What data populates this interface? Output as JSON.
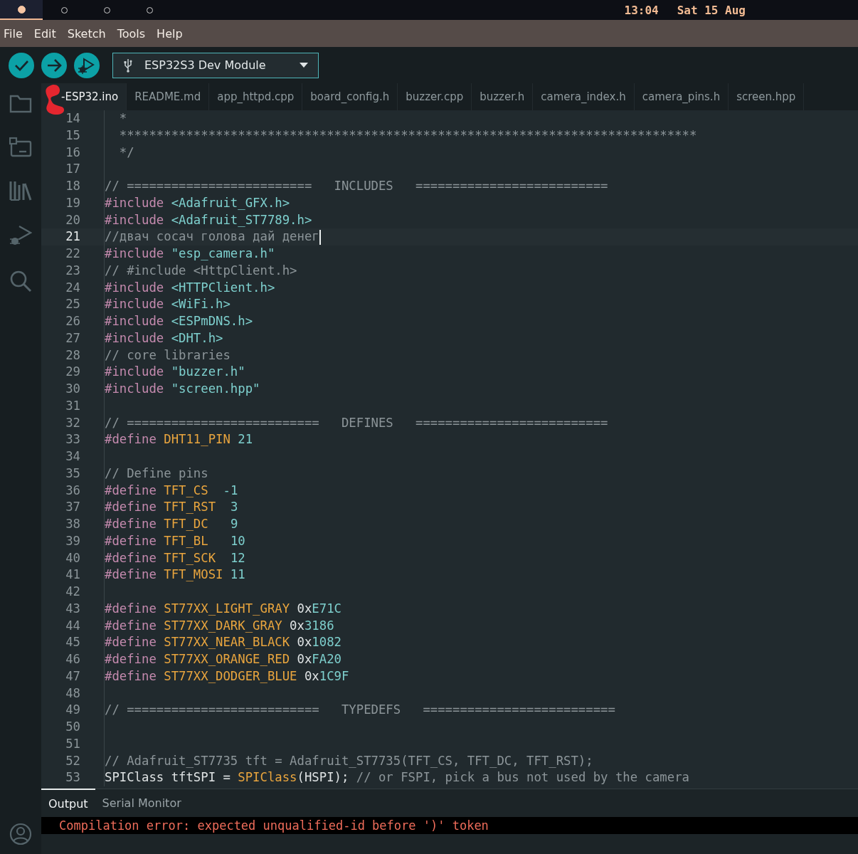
{
  "top_bar": {
    "workspaces": [
      {
        "selected": true
      },
      {
        "selected": false
      },
      {
        "selected": false
      },
      {
        "selected": false
      }
    ],
    "time": "13:04",
    "date": "Sat 15 Aug"
  },
  "menu": [
    "File",
    "Edit",
    "Sketch",
    "Tools",
    "Help"
  ],
  "toolbar": {
    "board": "ESP32S3 Dev Module"
  },
  "tabs": [
    {
      "label": "-ESP32.ino",
      "selected": true
    },
    {
      "label": "README.md",
      "selected": false
    },
    {
      "label": "app_httpd.cpp",
      "selected": false
    },
    {
      "label": "board_config.h",
      "selected": false
    },
    {
      "label": "buzzer.cpp",
      "selected": false
    },
    {
      "label": "buzzer.h",
      "selected": false
    },
    {
      "label": "camera_index.h",
      "selected": false
    },
    {
      "label": "camera_pins.h",
      "selected": false
    },
    {
      "label": "screen.hpp",
      "selected": false
    }
  ],
  "editor": {
    "lines": [
      {
        "number": "14",
        "current": false,
        "code": [
          {
            "kind": "comment",
            "text": "  *"
          }
        ]
      },
      {
        "number": "15",
        "current": false,
        "code": [
          {
            "kind": "comment",
            "text": "  ******************************************************************************"
          }
        ]
      },
      {
        "number": "16",
        "current": false,
        "code": [
          {
            "kind": "comment",
            "text": "  */"
          }
        ]
      },
      {
        "number": "17",
        "current": false
      },
      {
        "number": "18",
        "current": false,
        "code": [
          {
            "kind": "comment",
            "text": "// =========================   INCLUDES   =========================="
          }
        ]
      },
      {
        "number": "19",
        "current": false,
        "code": [
          {
            "kind": "directive",
            "text": "#include "
          },
          {
            "kind": "header",
            "text": "<Adafruit_GFX.h>"
          }
        ]
      },
      {
        "number": "20",
        "current": false,
        "code": [
          {
            "kind": "directive",
            "text": "#include "
          },
          {
            "kind": "header",
            "text": "<Adafruit_ST7789.h>"
          }
        ]
      },
      {
        "number": "21",
        "current": true,
        "code": [
          {
            "kind": "comment",
            "text": "//двач сосач голова дай денег"
          }
        ]
      },
      {
        "number": "22",
        "current": false,
        "code": [
          {
            "kind": "directive",
            "text": "#include "
          },
          {
            "kind": "header",
            "text": "\"esp_camera.h\""
          }
        ]
      },
      {
        "number": "23",
        "current": false,
        "code": [
          {
            "kind": "comment",
            "text": "// #include <HttpClient.h>"
          }
        ]
      },
      {
        "number": "24",
        "current": false,
        "code": [
          {
            "kind": "directive",
            "text": "#include "
          },
          {
            "kind": "header",
            "text": "<HTTPClient.h>"
          }
        ]
      },
      {
        "number": "25",
        "current": false,
        "code": [
          {
            "kind": "directive",
            "text": "#include "
          },
          {
            "kind": "header",
            "text": "<WiFi.h>"
          }
        ]
      },
      {
        "number": "26",
        "current": false,
        "code": [
          {
            "kind": "directive",
            "text": "#include "
          },
          {
            "kind": "header",
            "text": "<ESPmDNS.h>"
          }
        ]
      },
      {
        "number": "27",
        "current": false,
        "code": [
          {
            "kind": "directive",
            "text": "#include "
          },
          {
            "kind": "header",
            "text": "<DHT.h>"
          }
        ]
      },
      {
        "number": "28",
        "current": false,
        "code": [
          {
            "kind": "comment",
            "text": "// core libraries"
          }
        ]
      },
      {
        "number": "29",
        "current": false,
        "code": [
          {
            "kind": "directive",
            "text": "#include "
          },
          {
            "kind": "header",
            "text": "\"buzzer.h\""
          }
        ]
      },
      {
        "number": "30",
        "current": false,
        "code": [
          {
            "kind": "directive",
            "text": "#include "
          },
          {
            "kind": "header",
            "text": "\"screen.hpp\""
          }
        ]
      },
      {
        "number": "31",
        "current": false
      },
      {
        "number": "32",
        "current": false,
        "code": [
          {
            "kind": "comment",
            "text": "// ==========================   DEFINES   =========================="
          }
        ]
      },
      {
        "number": "33",
        "current": false,
        "code": [
          {
            "kind": "directive",
            "text": "#define "
          },
          {
            "kind": "macro",
            "text": "DHT11_PIN"
          },
          {
            "kind": "number",
            "text": " 21"
          }
        ]
      },
      {
        "number": "34",
        "current": false
      },
      {
        "number": "35",
        "current": false,
        "code": [
          {
            "kind": "comment",
            "text": "// Define pins"
          }
        ]
      },
      {
        "number": "36",
        "current": false,
        "code": [
          {
            "kind": "directive",
            "text": "#define "
          },
          {
            "kind": "macro",
            "text": "TFT_CS"
          },
          {
            "kind": "number",
            "text": "  -1"
          }
        ]
      },
      {
        "number": "37",
        "current": false,
        "code": [
          {
            "kind": "directive",
            "text": "#define "
          },
          {
            "kind": "macro",
            "text": "TFT_RST"
          },
          {
            "kind": "number",
            "text": "  3"
          }
        ]
      },
      {
        "number": "38",
        "current": false,
        "code": [
          {
            "kind": "directive",
            "text": "#define "
          },
          {
            "kind": "macro",
            "text": "TFT_DC"
          },
          {
            "kind": "number",
            "text": "   9"
          }
        ]
      },
      {
        "number": "39",
        "current": false,
        "code": [
          {
            "kind": "directive",
            "text": "#define "
          },
          {
            "kind": "macro",
            "text": "TFT_BL"
          },
          {
            "kind": "number",
            "text": "   10"
          }
        ]
      },
      {
        "number": "40",
        "current": false,
        "code": [
          {
            "kind": "directive",
            "text": "#define "
          },
          {
            "kind": "macro",
            "text": "TFT_SCK"
          },
          {
            "kind": "number",
            "text": "  12"
          }
        ]
      },
      {
        "number": "41",
        "current": false,
        "code": [
          {
            "kind": "directive",
            "text": "#define "
          },
          {
            "kind": "macro",
            "text": "TFT_MOSI"
          },
          {
            "kind": "number",
            "text": " 11"
          }
        ]
      },
      {
        "number": "42",
        "current": false
      },
      {
        "number": "43",
        "current": false,
        "code": [
          {
            "kind": "directive",
            "text": "#define "
          },
          {
            "kind": "macro",
            "text": "ST77XX_LIGHT_GRAY"
          },
          {
            "kind": "plain",
            "text": " 0x"
          },
          {
            "kind": "number",
            "text": "E71C"
          }
        ]
      },
      {
        "number": "44",
        "current": false,
        "code": [
          {
            "kind": "directive",
            "text": "#define "
          },
          {
            "kind": "macro",
            "text": "ST77XX_DARK_GRAY"
          },
          {
            "kind": "plain",
            "text": " 0x"
          },
          {
            "kind": "number",
            "text": "3186"
          }
        ]
      },
      {
        "number": "45",
        "current": false,
        "code": [
          {
            "kind": "directive",
            "text": "#define "
          },
          {
            "kind": "macro",
            "text": "ST77XX_NEAR_BLACK"
          },
          {
            "kind": "plain",
            "text": " 0x"
          },
          {
            "kind": "number",
            "text": "1082"
          }
        ]
      },
      {
        "number": "46",
        "current": false,
        "code": [
          {
            "kind": "directive",
            "text": "#define "
          },
          {
            "kind": "macro",
            "text": "ST77XX_ORANGE_RED"
          },
          {
            "kind": "plain",
            "text": " 0x"
          },
          {
            "kind": "number",
            "text": "FA20"
          }
        ]
      },
      {
        "number": "47",
        "current": false,
        "code": [
          {
            "kind": "directive",
            "text": "#define "
          },
          {
            "kind": "macro",
            "text": "ST77XX_DODGER_BLUE"
          },
          {
            "kind": "plain",
            "text": " 0x"
          },
          {
            "kind": "number",
            "text": "1C9F"
          }
        ]
      },
      {
        "number": "48",
        "current": false
      },
      {
        "number": "49",
        "current": false,
        "code": [
          {
            "kind": "comment",
            "text": "// ==========================   TYPEDEFS   =========================="
          }
        ]
      },
      {
        "number": "50",
        "current": false
      },
      {
        "number": "51",
        "current": false
      },
      {
        "number": "52",
        "current": false,
        "code": [
          {
            "kind": "comment",
            "text": "// Adafruit_ST7735 tft = Adafruit_ST7735(TFT_CS, TFT_DC, TFT_RST);"
          }
        ]
      },
      {
        "number": "53",
        "current": false,
        "code": [
          {
            "kind": "plain",
            "text": "SPIClass tftSPI = "
          },
          {
            "kind": "function",
            "text": "SPIClass"
          },
          {
            "kind": "plain",
            "text": "(HSPI); "
          },
          {
            "kind": "comment",
            "text": "// or FSPI, pick a bus not used by the camera"
          }
        ]
      }
    ]
  },
  "output": {
    "tabs": [
      {
        "label": "Output",
        "selected": true
      },
      {
        "label": "Serial Monitor",
        "selected": false
      }
    ],
    "message": "Compilation error: expected unqualified-id before ')' token"
  }
}
